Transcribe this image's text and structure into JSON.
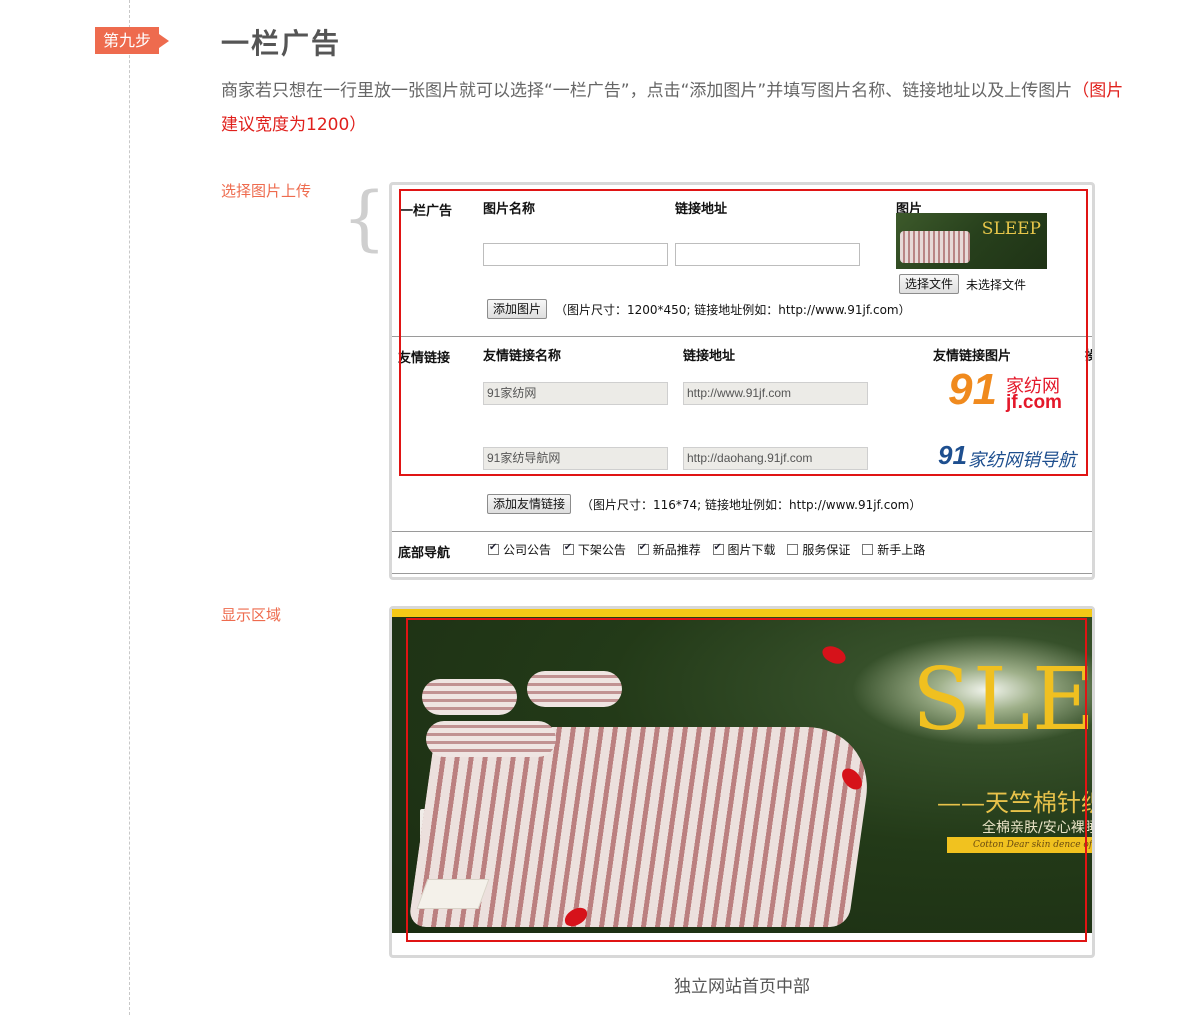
{
  "step": {
    "badge": "第九步"
  },
  "title": "一栏广告",
  "intro": {
    "text": "商家若只想在一行里放一张图片就可以选择“一栏广告”，点击“添加图片”并填写图片名称、链接地址以及上传图片",
    "note": "（图片建议宽度为1200）"
  },
  "labels": {
    "upload": "选择图片上传",
    "display": "显示区域"
  },
  "form": {
    "ad_section": {
      "label": "一栏广告",
      "col_name": "图片名称",
      "col_link": "链接地址",
      "col_image": "图片",
      "thumb_text": "SLEEP",
      "file_button": "选择文件",
      "file_status": "未选择文件",
      "add_button": "添加图片",
      "hint": "（图片尺寸：1200*450; 链接地址例如：http://www.91jf.com）"
    },
    "links_section": {
      "label": "友情链接",
      "col_name": "友情链接名称",
      "col_link": "链接地址",
      "col_image": "友情链接图片",
      "col_extra": "操",
      "rows": [
        {
          "name": "91家纺网",
          "url": "http://www.91jf.com",
          "logo_num": "91",
          "logo_cn": "家纺网",
          "logo_en": "jf.com"
        },
        {
          "name": "91家纺导航网",
          "url": "http://daohang.91jf.com",
          "logo_num": "91",
          "logo_cn": "家纺网销导航"
        }
      ],
      "add_button": "添加友情链接",
      "hint": "（图片尺寸：116*74; 链接地址例如：http://www.91jf.com）"
    },
    "footer_nav": {
      "label": "底部导航",
      "items": [
        {
          "label": "公司公告",
          "checked": true
        },
        {
          "label": "下架公告",
          "checked": true
        },
        {
          "label": "新品推荐",
          "checked": true
        },
        {
          "label": "图片下载",
          "checked": true
        },
        {
          "label": "服务保证",
          "checked": false
        },
        {
          "label": "新手上路",
          "checked": false
        }
      ]
    }
  },
  "banner": {
    "headline": "SLEEP",
    "line1": "——天竺棉针织四件",
    "line2": "全棉亲肤/安心裸睡",
    "line3": "Cotton Dear skin dence of mind"
  },
  "caption": "独立网站首页中部",
  "colors": {
    "accent": "#ee6b4e",
    "red": "#e0201c",
    "frame": "#e01414"
  }
}
